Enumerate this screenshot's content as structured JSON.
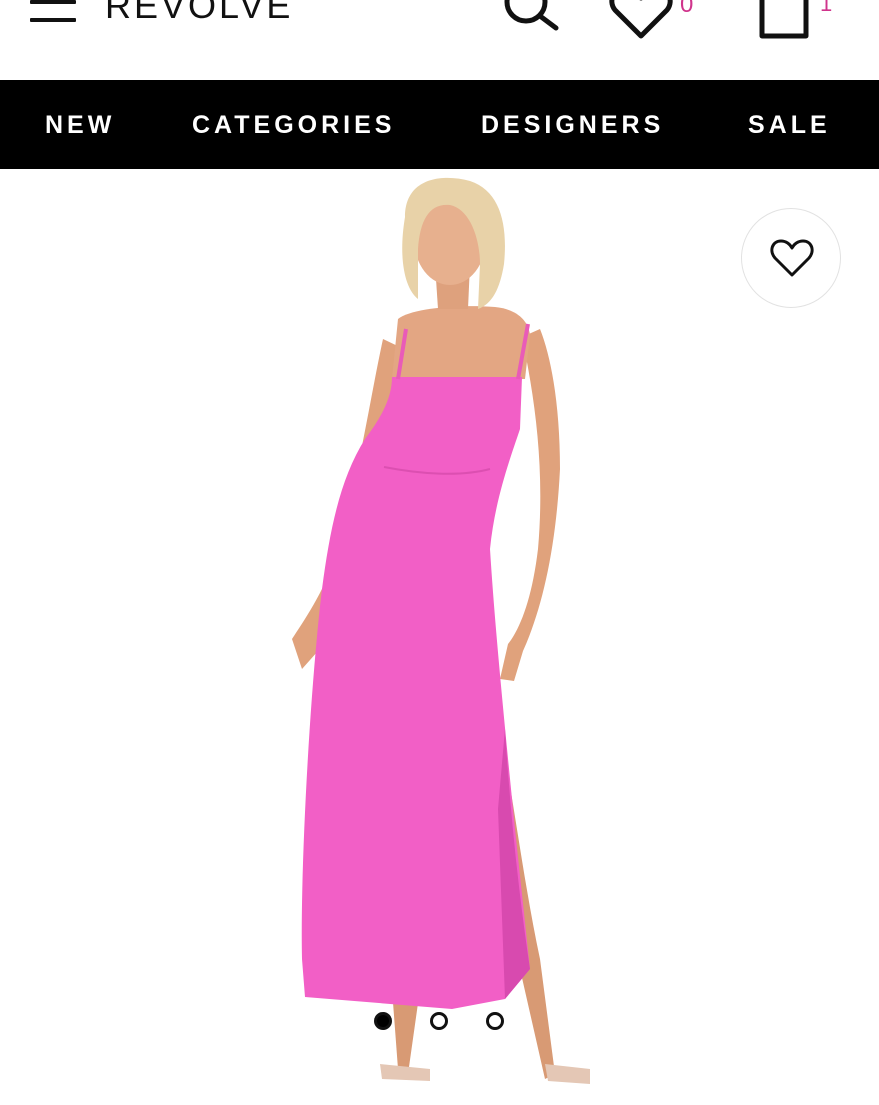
{
  "header": {
    "logo": "REVOLVE",
    "wishlist_count": "0",
    "bag_count": "1",
    "icons": [
      "menu-icon",
      "search-icon",
      "heart-icon",
      "shopping-bag-icon"
    ],
    "accent_color": "#d0348c"
  },
  "nav": {
    "items": [
      {
        "label": "NEW"
      },
      {
        "label": "CATEGORIES"
      },
      {
        "label": "DESIGNERS"
      },
      {
        "label": "SALE"
      }
    ],
    "background": "#000000"
  },
  "product": {
    "image": "model wearing pink maxi dress with spaghetti straps and side slit",
    "dress_color": "#f25fc6",
    "favorite_icon": "heart-outline-icon"
  },
  "carousel": {
    "count": 3,
    "active_index": 0
  }
}
